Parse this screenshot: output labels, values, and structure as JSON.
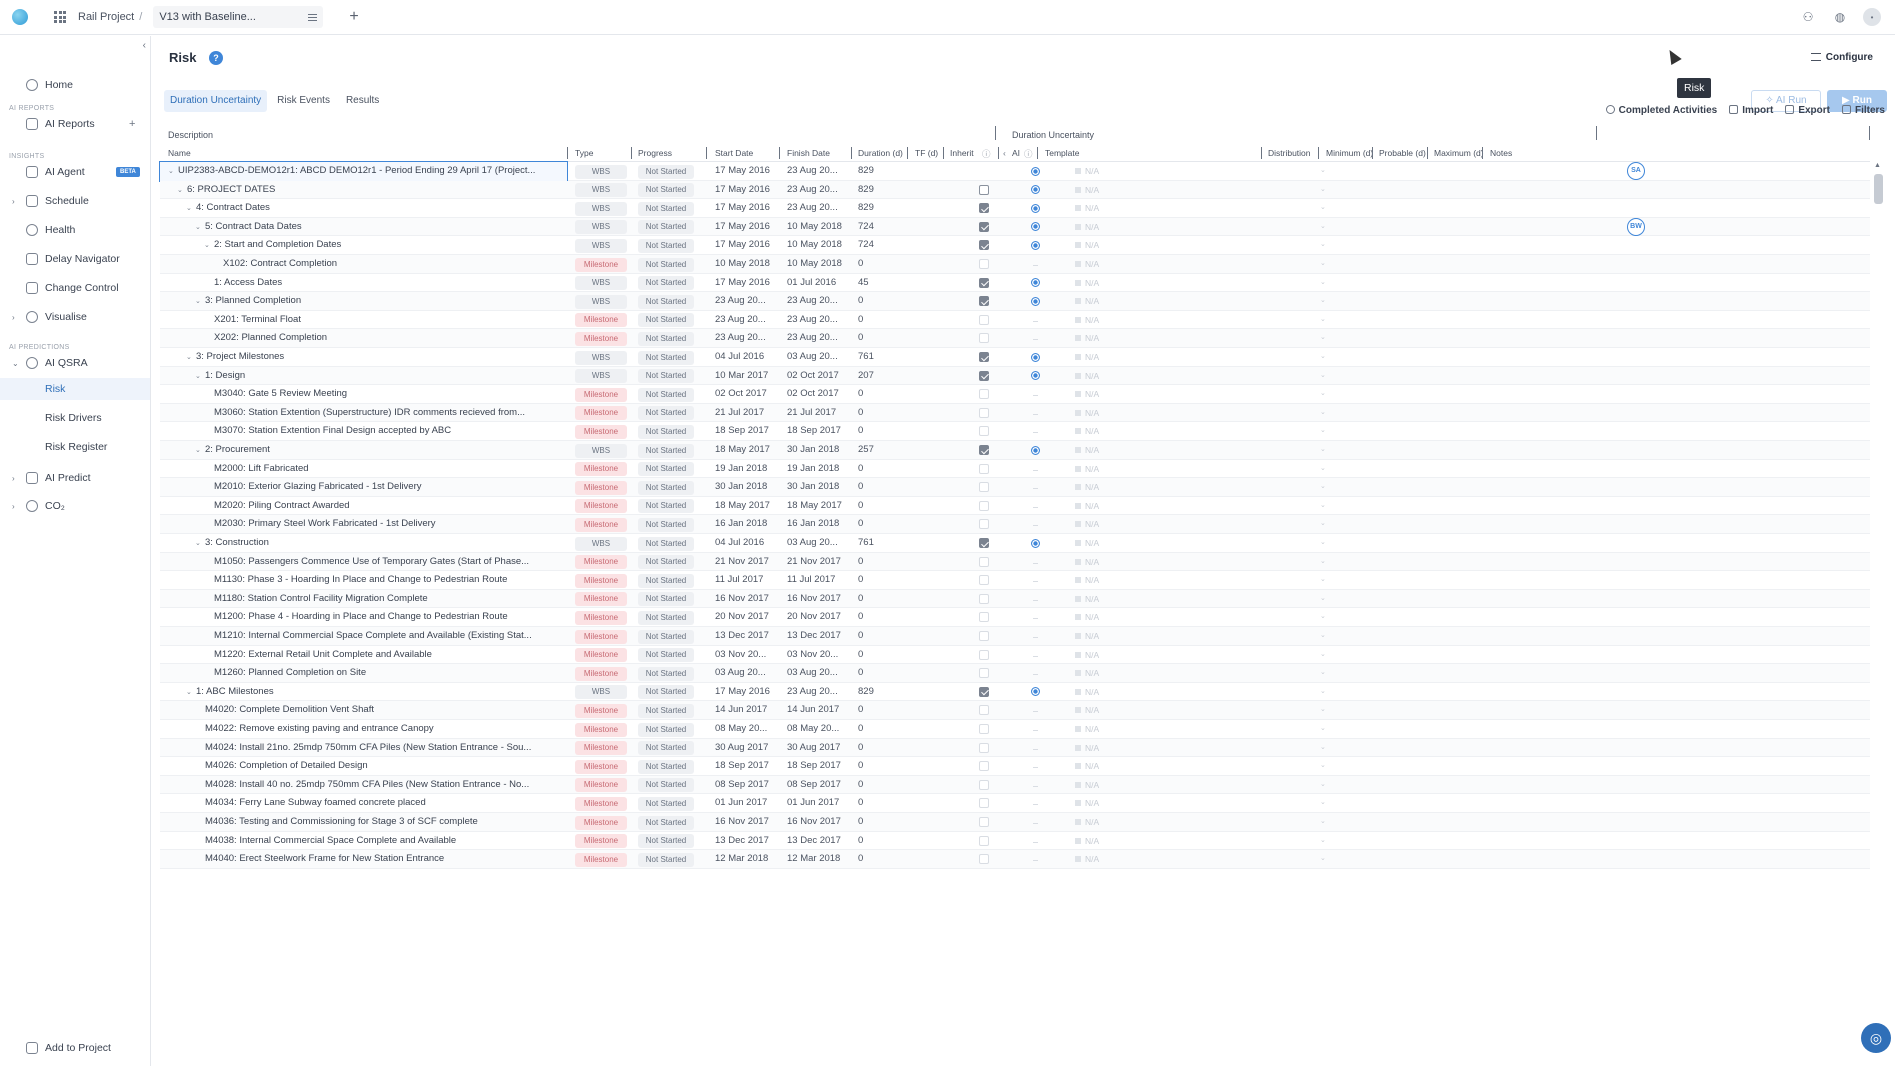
{
  "topbar": {
    "project": "Rail Project",
    "version": "V13 with Baseline..."
  },
  "sidebar": {
    "home": "Home",
    "section_reports": "AI REPORTS",
    "ai_reports": "AI Reports",
    "section_insights": "INSIGHTS",
    "ai_agent": "AI Agent",
    "beta": "BETA",
    "schedule": "Schedule",
    "health": "Health",
    "delay_navigator": "Delay Navigator",
    "change_control": "Change Control",
    "visualise": "Visualise",
    "section_predictions": "AI PREDICTIONS",
    "ai_qsra": "AI QSRA",
    "risk": "Risk",
    "risk_drivers": "Risk Drivers",
    "risk_register": "Risk Register",
    "ai_predict": "AI Predict",
    "co2": "CO₂",
    "add_to_project": "Add to Project"
  },
  "header": {
    "title": "Risk",
    "help": "?",
    "configure": "Configure",
    "tooltip": "Risk",
    "ai_run": "AI Run",
    "run": "Run"
  },
  "tabs": [
    "Duration Uncertainty",
    "Risk Events",
    "Results"
  ],
  "toolbar": {
    "completed": "Completed Activities",
    "import": "Import",
    "export": "Export",
    "filters": "Filters"
  },
  "groups": {
    "description": "Description",
    "duration_uncertainty": "Duration Uncertainty"
  },
  "columns": {
    "name": "Name",
    "type": "Type",
    "progress": "Progress",
    "start": "Start Date",
    "finish": "Finish Date",
    "duration": "Duration (d)",
    "tf": "TF (d)",
    "inherit": "Inherit",
    "ai": "AI",
    "template": "Template",
    "distribution": "Distribution",
    "minimum": "Minimum (d)",
    "probable": "Probable (d)",
    "maximum": "Maximum (d)",
    "notes": "Notes"
  },
  "template_na": "N/A",
  "rows": [
    {
      "name": "UIP2383-ABCD-DEMO12r1: ABCD DEMO12r1 - Period Ending 29 April 17 (Project...",
      "level": 0,
      "exp": true,
      "type": "WBS",
      "progress": "Not Started",
      "start": "17 May 2016",
      "finish": "23 Aug 20...",
      "dur": "829",
      "inherit": "none",
      "ai": "on",
      "note": "SA"
    },
    {
      "name": "6: PROJECT DATES",
      "level": 1,
      "exp": true,
      "type": "WBS",
      "progress": "Not Started",
      "start": "17 May 2016",
      "finish": "23 Aug 20...",
      "dur": "829",
      "inherit": "off",
      "ai": "on",
      "note": ""
    },
    {
      "name": "4: Contract Dates",
      "level": 2,
      "exp": true,
      "type": "WBS",
      "progress": "Not Started",
      "start": "17 May 2016",
      "finish": "23 Aug 20...",
      "dur": "829",
      "inherit": "on",
      "ai": "on",
      "note": ""
    },
    {
      "name": "5: Contract Data Dates",
      "level": 3,
      "exp": true,
      "type": "WBS",
      "progress": "Not Started",
      "start": "17 May 2016",
      "finish": "10 May 2018",
      "dur": "724",
      "inherit": "on",
      "ai": "on",
      "note": "BW"
    },
    {
      "name": "2: Start and Completion Dates",
      "level": 4,
      "exp": true,
      "type": "WBS",
      "progress": "Not Started",
      "start": "17 May 2016",
      "finish": "10 May 2018",
      "dur": "724",
      "inherit": "on",
      "ai": "on",
      "note": ""
    },
    {
      "name": "X102: Contract Completion",
      "level": 5,
      "exp": false,
      "type": "Milestone",
      "progress": "Not Started",
      "start": "10 May 2018",
      "finish": "10 May 2018",
      "dur": "0",
      "inherit": "faint",
      "ai": "dash",
      "note": ""
    },
    {
      "name": "1: Access Dates",
      "level": 4,
      "exp": false,
      "type": "WBS",
      "progress": "Not Started",
      "start": "17 May 2016",
      "finish": "01 Jul 2016",
      "dur": "45",
      "inherit": "on",
      "ai": "on",
      "note": ""
    },
    {
      "name": "3: Planned Completion",
      "level": 3,
      "exp": true,
      "type": "WBS",
      "progress": "Not Started",
      "start": "23 Aug 20...",
      "finish": "23 Aug 20...",
      "dur": "0",
      "inherit": "on",
      "ai": "on",
      "note": ""
    },
    {
      "name": "X201: Terminal Float",
      "level": 4,
      "exp": false,
      "type": "Milestone",
      "progress": "Not Started",
      "start": "23 Aug 20...",
      "finish": "23 Aug 20...",
      "dur": "0",
      "inherit": "faint",
      "ai": "dash",
      "note": ""
    },
    {
      "name": "X202: Planned Completion",
      "level": 4,
      "exp": false,
      "type": "Milestone",
      "progress": "Not Started",
      "start": "23 Aug 20...",
      "finish": "23 Aug 20...",
      "dur": "0",
      "inherit": "faint",
      "ai": "dash",
      "note": ""
    },
    {
      "name": "3: Project Milestones",
      "level": 2,
      "exp": true,
      "type": "WBS",
      "progress": "Not Started",
      "start": "04 Jul 2016",
      "finish": "03 Aug 20...",
      "dur": "761",
      "inherit": "on",
      "ai": "on",
      "note": ""
    },
    {
      "name": "1: Design",
      "level": 3,
      "exp": true,
      "type": "WBS",
      "progress": "Not Started",
      "start": "10 Mar 2017",
      "finish": "02 Oct 2017",
      "dur": "207",
      "inherit": "on",
      "ai": "on",
      "note": ""
    },
    {
      "name": "M3040: Gate 5 Review Meeting",
      "level": 4,
      "exp": false,
      "type": "Milestone",
      "progress": "Not Started",
      "start": "02 Oct 2017",
      "finish": "02 Oct 2017",
      "dur": "0",
      "inherit": "faint",
      "ai": "dash",
      "note": ""
    },
    {
      "name": "M3060: Station Extention (Superstructure) IDR comments recieved from...",
      "level": 4,
      "exp": false,
      "type": "Milestone",
      "progress": "Not Started",
      "start": "21 Jul 2017",
      "finish": "21 Jul 2017",
      "dur": "0",
      "inherit": "faint",
      "ai": "dash",
      "note": ""
    },
    {
      "name": "M3070: Station Extention Final Design accepted by ABC",
      "level": 4,
      "exp": false,
      "type": "Milestone",
      "progress": "Not Started",
      "start": "18 Sep 2017",
      "finish": "18 Sep 2017",
      "dur": "0",
      "inherit": "faint",
      "ai": "dash",
      "note": ""
    },
    {
      "name": "2: Procurement",
      "level": 3,
      "exp": true,
      "type": "WBS",
      "progress": "Not Started",
      "start": "18 May 2017",
      "finish": "30 Jan 2018",
      "dur": "257",
      "inherit": "on",
      "ai": "on",
      "note": ""
    },
    {
      "name": "M2000: Lift Fabricated",
      "level": 4,
      "exp": false,
      "type": "Milestone",
      "progress": "Not Started",
      "start": "19 Jan 2018",
      "finish": "19 Jan 2018",
      "dur": "0",
      "inherit": "faint",
      "ai": "dash",
      "note": ""
    },
    {
      "name": "M2010: Exterior Glazing Fabricated - 1st Delivery",
      "level": 4,
      "exp": false,
      "type": "Milestone",
      "progress": "Not Started",
      "start": "30 Jan 2018",
      "finish": "30 Jan 2018",
      "dur": "0",
      "inherit": "faint",
      "ai": "dash",
      "note": ""
    },
    {
      "name": "M2020: Piling Contract Awarded",
      "level": 4,
      "exp": false,
      "type": "Milestone",
      "progress": "Not Started",
      "start": "18 May 2017",
      "finish": "18 May 2017",
      "dur": "0",
      "inherit": "faint",
      "ai": "dash",
      "note": ""
    },
    {
      "name": "M2030: Primary Steel Work Fabricated - 1st Delivery",
      "level": 4,
      "exp": false,
      "type": "Milestone",
      "progress": "Not Started",
      "start": "16 Jan 2018",
      "finish": "16 Jan 2018",
      "dur": "0",
      "inherit": "faint",
      "ai": "dash",
      "note": ""
    },
    {
      "name": "3: Construction",
      "level": 3,
      "exp": true,
      "type": "WBS",
      "progress": "Not Started",
      "start": "04 Jul 2016",
      "finish": "03 Aug 20...",
      "dur": "761",
      "inherit": "on",
      "ai": "on",
      "note": ""
    },
    {
      "name": "M1050: Passengers Commence Use of Temporary Gates (Start of Phase...",
      "level": 4,
      "exp": false,
      "type": "Milestone",
      "progress": "Not Started",
      "start": "21 Nov 2017",
      "finish": "21 Nov 2017",
      "dur": "0",
      "inherit": "faint",
      "ai": "dash",
      "note": ""
    },
    {
      "name": "M1130: Phase 3 - Hoarding In Place and Change to Pedestrian Route",
      "level": 4,
      "exp": false,
      "type": "Milestone",
      "progress": "Not Started",
      "start": "11 Jul 2017",
      "finish": "11 Jul 2017",
      "dur": "0",
      "inherit": "faint",
      "ai": "dash",
      "note": ""
    },
    {
      "name": "M1180: Station Control Facility Migration Complete",
      "level": 4,
      "exp": false,
      "type": "Milestone",
      "progress": "Not Started",
      "start": "16 Nov 2017",
      "finish": "16 Nov 2017",
      "dur": "0",
      "inherit": "faint",
      "ai": "dash",
      "note": ""
    },
    {
      "name": "M1200: Phase 4 - Hoarding in Place and Change to Pedestrian Route",
      "level": 4,
      "exp": false,
      "type": "Milestone",
      "progress": "Not Started",
      "start": "20 Nov 2017",
      "finish": "20 Nov 2017",
      "dur": "0",
      "inherit": "faint",
      "ai": "dash",
      "note": ""
    },
    {
      "name": "M1210: Internal Commercial Space Complete and Available (Existing Stat...",
      "level": 4,
      "exp": false,
      "type": "Milestone",
      "progress": "Not Started",
      "start": "13 Dec 2017",
      "finish": "13 Dec 2017",
      "dur": "0",
      "inherit": "faint",
      "ai": "dash",
      "note": ""
    },
    {
      "name": "M1220: External Retail Unit Complete and Available",
      "level": 4,
      "exp": false,
      "type": "Milestone",
      "progress": "Not Started",
      "start": "03 Nov 20...",
      "finish": "03 Nov 20...",
      "dur": "0",
      "inherit": "faint",
      "ai": "dash",
      "note": ""
    },
    {
      "name": "M1260: Planned Completion on Site",
      "level": 4,
      "exp": false,
      "type": "Milestone",
      "progress": "Not Started",
      "start": "03 Aug 20...",
      "finish": "03 Aug 20...",
      "dur": "0",
      "inherit": "faint",
      "ai": "dash",
      "note": ""
    },
    {
      "name": "1: ABC Milestones",
      "level": 2,
      "exp": true,
      "type": "WBS",
      "progress": "Not Started",
      "start": "17 May 2016",
      "finish": "23 Aug 20...",
      "dur": "829",
      "inherit": "on",
      "ai": "on",
      "note": ""
    },
    {
      "name": "M4020: Complete Demolition Vent Shaft",
      "level": 3,
      "exp": false,
      "type": "Milestone",
      "progress": "Not Started",
      "start": "14 Jun 2017",
      "finish": "14 Jun 2017",
      "dur": "0",
      "inherit": "faint",
      "ai": "dash",
      "note": ""
    },
    {
      "name": "M4022: Remove existing paving and entrance Canopy",
      "level": 3,
      "exp": false,
      "type": "Milestone",
      "progress": "Not Started",
      "start": "08 May 20...",
      "finish": "08 May 20...",
      "dur": "0",
      "inherit": "faint",
      "ai": "dash",
      "note": ""
    },
    {
      "name": "M4024: Install 21no. 25mdp 750mm CFA Piles (New Station Entrance - Sou...",
      "level": 3,
      "exp": false,
      "type": "Milestone",
      "progress": "Not Started",
      "start": "30 Aug 2017",
      "finish": "30 Aug 2017",
      "dur": "0",
      "inherit": "faint",
      "ai": "dash",
      "note": ""
    },
    {
      "name": "M4026: Completion of Detailed Design",
      "level": 3,
      "exp": false,
      "type": "Milestone",
      "progress": "Not Started",
      "start": "18 Sep 2017",
      "finish": "18 Sep 2017",
      "dur": "0",
      "inherit": "faint",
      "ai": "dash",
      "note": ""
    },
    {
      "name": "M4028: Install 40 no. 25mdp 750mm CFA Piles (New Station Entrance - No...",
      "level": 3,
      "exp": false,
      "type": "Milestone",
      "progress": "Not Started",
      "start": "08 Sep 2017",
      "finish": "08 Sep 2017",
      "dur": "0",
      "inherit": "faint",
      "ai": "dash",
      "note": ""
    },
    {
      "name": "M4034: Ferry Lane Subway foamed concrete placed",
      "level": 3,
      "exp": false,
      "type": "Milestone",
      "progress": "Not Started",
      "start": "01 Jun 2017",
      "finish": "01 Jun 2017",
      "dur": "0",
      "inherit": "faint",
      "ai": "dash",
      "note": ""
    },
    {
      "name": "M4036: Testing and Commissioning for Stage 3 of SCF complete",
      "level": 3,
      "exp": false,
      "type": "Milestone",
      "progress": "Not Started",
      "start": "16 Nov 2017",
      "finish": "16 Nov 2017",
      "dur": "0",
      "inherit": "faint",
      "ai": "dash",
      "note": ""
    },
    {
      "name": "M4038: Internal Commercial Space Complete and Available",
      "level": 3,
      "exp": false,
      "type": "Milestone",
      "progress": "Not Started",
      "start": "13 Dec 2017",
      "finish": "13 Dec 2017",
      "dur": "0",
      "inherit": "faint",
      "ai": "dash",
      "note": ""
    },
    {
      "name": "M4040: Erect Steelwork Frame for New Station Entrance",
      "level": 3,
      "exp": false,
      "type": "Milestone",
      "progress": "Not Started",
      "start": "12 Mar 2018",
      "finish": "12 Mar 2018",
      "dur": "0",
      "inherit": "faint",
      "ai": "dash",
      "note": ""
    }
  ]
}
